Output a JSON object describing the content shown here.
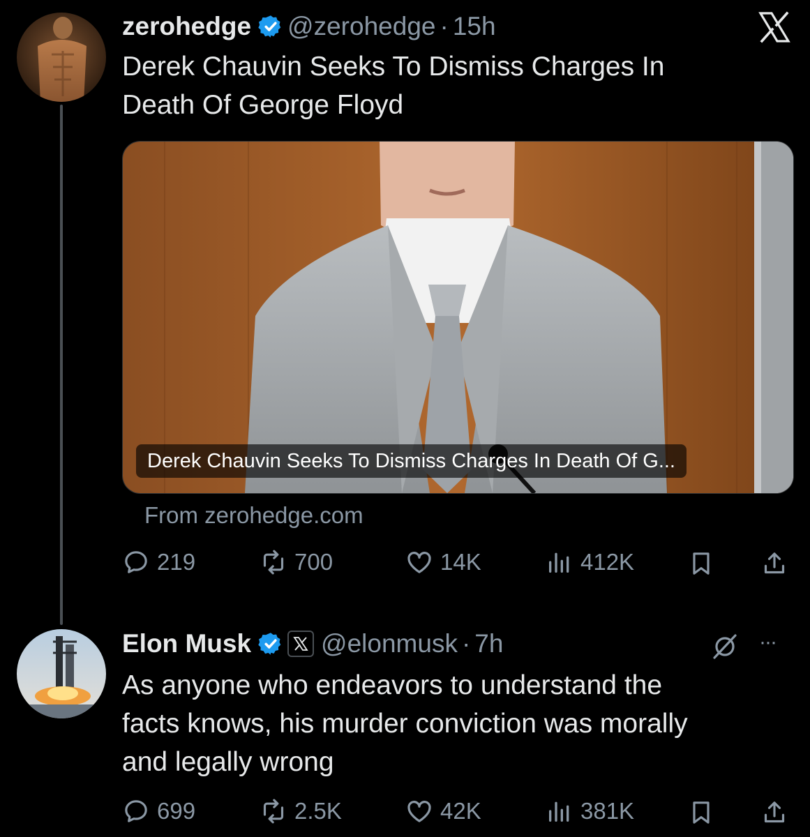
{
  "tweet1": {
    "author_name": "zerohedge",
    "handle": "@zerohedge",
    "time": "15h",
    "text_line1": "Derek Chauvin Seeks To Dismiss Charges In",
    "text_line2": "Death Of George Floyd",
    "card_title": "Derek Chauvin Seeks To Dismiss Charges In Death Of G...",
    "card_source": "From zerohedge.com",
    "replies": "219",
    "reposts": "700",
    "likes": "14K",
    "views": "412K"
  },
  "tweet2": {
    "author_name": "Elon Musk",
    "handle": "@elonmusk",
    "time": "7h",
    "text_line1": "As anyone who endeavors to understand the",
    "text_line2": "facts knows, his murder conviction was morally",
    "text_line3": "and legally wrong",
    "replies": "699",
    "reposts": "2.5K",
    "likes": "42K",
    "views": "381K"
  },
  "separator_dot": "·",
  "more_label": "···",
  "icons": {
    "close": "x-logo-icon",
    "verified": "verified-badge-icon",
    "reply": "reply-icon",
    "repost": "repost-icon",
    "like": "heart-icon",
    "views": "views-icon",
    "bookmark": "bookmark-icon",
    "share": "share-icon",
    "grok": "grok-icon",
    "affiliate": "x-affiliate-badge-icon"
  },
  "colors": {
    "background": "#000000",
    "text": "#e7e9ea",
    "secondary": "#8b98a5",
    "verified": "#1d9bf0"
  }
}
